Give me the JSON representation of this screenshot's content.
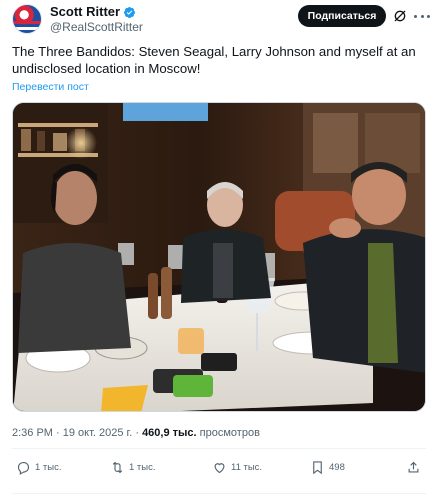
{
  "author": {
    "display_name": "Scott Ritter",
    "handle": "@RealScottRitter",
    "verified": true
  },
  "header": {
    "subscribe_label": "Подписаться"
  },
  "post": {
    "text": "The Three Bandidos: Steven Seagal, Larry Johnson and myself at an undisclosed location in Moscow!",
    "translate_label": "Перевести пост",
    "timestamp": "2:36 PM · 19 окт. 2025 г. ·",
    "views_count": "460,9 тыс.",
    "views_label": "просмотров"
  },
  "actions": {
    "replies": "1 тыс.",
    "reposts": "1 тыс.",
    "likes": "11 тыс.",
    "bookmarks": "498"
  },
  "icons": [
    "verified-badge-icon",
    "grok-icon",
    "more-icon",
    "reply-icon",
    "repost-icon",
    "like-icon",
    "bookmark-icon",
    "share-icon"
  ],
  "colors": {
    "accent": "#1d9bf0",
    "text": "#0f1419",
    "secondary": "#536471",
    "button_bg": "#0f1419"
  }
}
